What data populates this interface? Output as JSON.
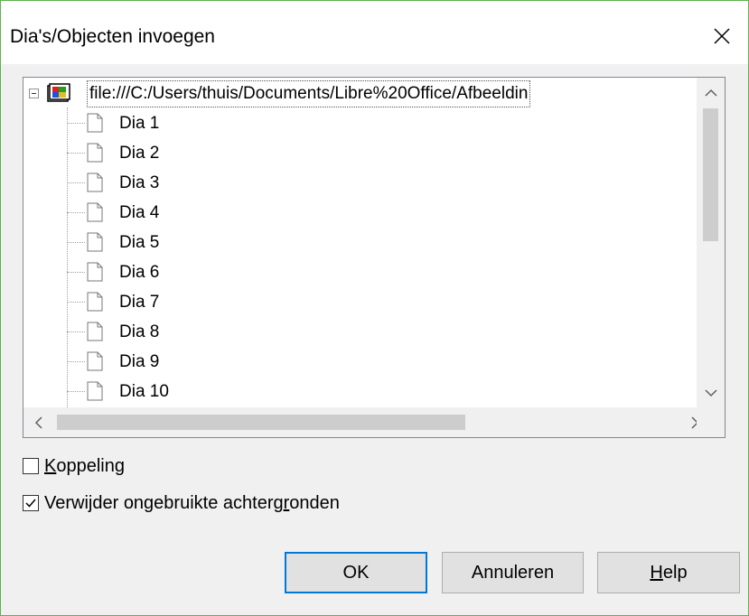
{
  "dialog": {
    "title": "Dia's/Objecten invoegen"
  },
  "tree": {
    "root_label": "file:///C:/Users/thuis/Documents/Libre%20Office/Afbeeldin",
    "items": [
      "Dia 1",
      "Dia 2",
      "Dia 3",
      "Dia 4",
      "Dia 5",
      "Dia 6",
      "Dia 7",
      "Dia 8",
      "Dia 9",
      "Dia 10"
    ]
  },
  "options": {
    "link": {
      "pre": "",
      "accel": "K",
      "post": "oppeling",
      "checked": false
    },
    "remove_backgrounds": {
      "pre": "Verwijder ongebruikte achterg",
      "accel": "r",
      "post": "onden",
      "checked": true
    }
  },
  "buttons": {
    "ok": "OK",
    "cancel": "Annuleren",
    "help_accel": "H",
    "help_rest": "elp"
  },
  "icons": [
    "close-icon",
    "collapse-icon",
    "presentation-icon",
    "page-icon",
    "scroll-up-icon",
    "scroll-down-icon",
    "scroll-left-icon",
    "scroll-right-icon",
    "checkmark-icon"
  ]
}
